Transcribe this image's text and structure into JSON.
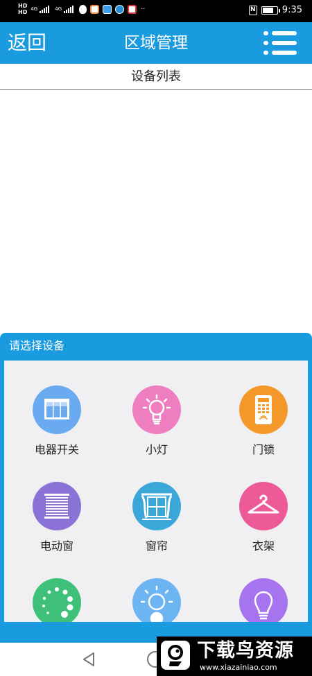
{
  "status_bar": {
    "hd_top": "HD",
    "hd_bottom": "HD",
    "network_1": "4G",
    "network_2": "4G",
    "nfc": "N",
    "battery_level": 0.75,
    "time": "9:35",
    "more": "··"
  },
  "header": {
    "back_label": "返回",
    "title": "区域管理"
  },
  "subheader": {
    "title": "设备列表"
  },
  "device_list": {
    "items": []
  },
  "panel": {
    "title": "请选择设备",
    "devices": [
      {
        "label": "电器开关",
        "icon": "switch-panel-icon",
        "color": "#6aaaf0"
      },
      {
        "label": "小灯",
        "icon": "light-bulb-icon",
        "color": "#ee7ec0"
      },
      {
        "label": "门锁",
        "icon": "door-lock-icon",
        "color": "#f4982a"
      },
      {
        "label": "电动窗",
        "icon": "blinds-icon",
        "color": "#8a72d6"
      },
      {
        "label": "窗帘",
        "icon": "curtain-icon",
        "color": "#3aa7d8"
      },
      {
        "label": "衣架",
        "icon": "clothes-hanger-icon",
        "color": "#ee5a98"
      },
      {
        "label": "",
        "icon": "dotted-circle-icon",
        "color": "#3fc078"
      },
      {
        "label": "",
        "icon": "sunrise-lamp-icon",
        "color": "#6cb4f2"
      },
      {
        "label": "",
        "icon": "bulb-lamp-icon",
        "color": "#a574ee"
      }
    ]
  },
  "watermark": {
    "title": "下载鸟资源",
    "url": "www.xiazainiao.com"
  }
}
